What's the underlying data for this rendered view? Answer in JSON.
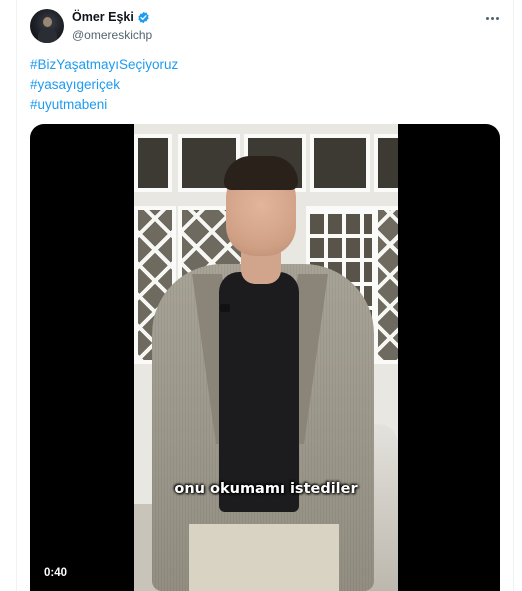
{
  "author": {
    "display_name": "Ömer Eşki",
    "handle": "@omereskichp",
    "verified": true
  },
  "hashtags": [
    "#BizYaşatmayıSeçiyoruz",
    "#yasayıgeriçek",
    "#uyutmabeni"
  ],
  "video": {
    "caption": "onu okumamı istediler",
    "duration": "0:40"
  },
  "colors": {
    "link": "#1d9bf0",
    "verified_badge": "#1d9bf0",
    "secondary_text": "#536471"
  }
}
